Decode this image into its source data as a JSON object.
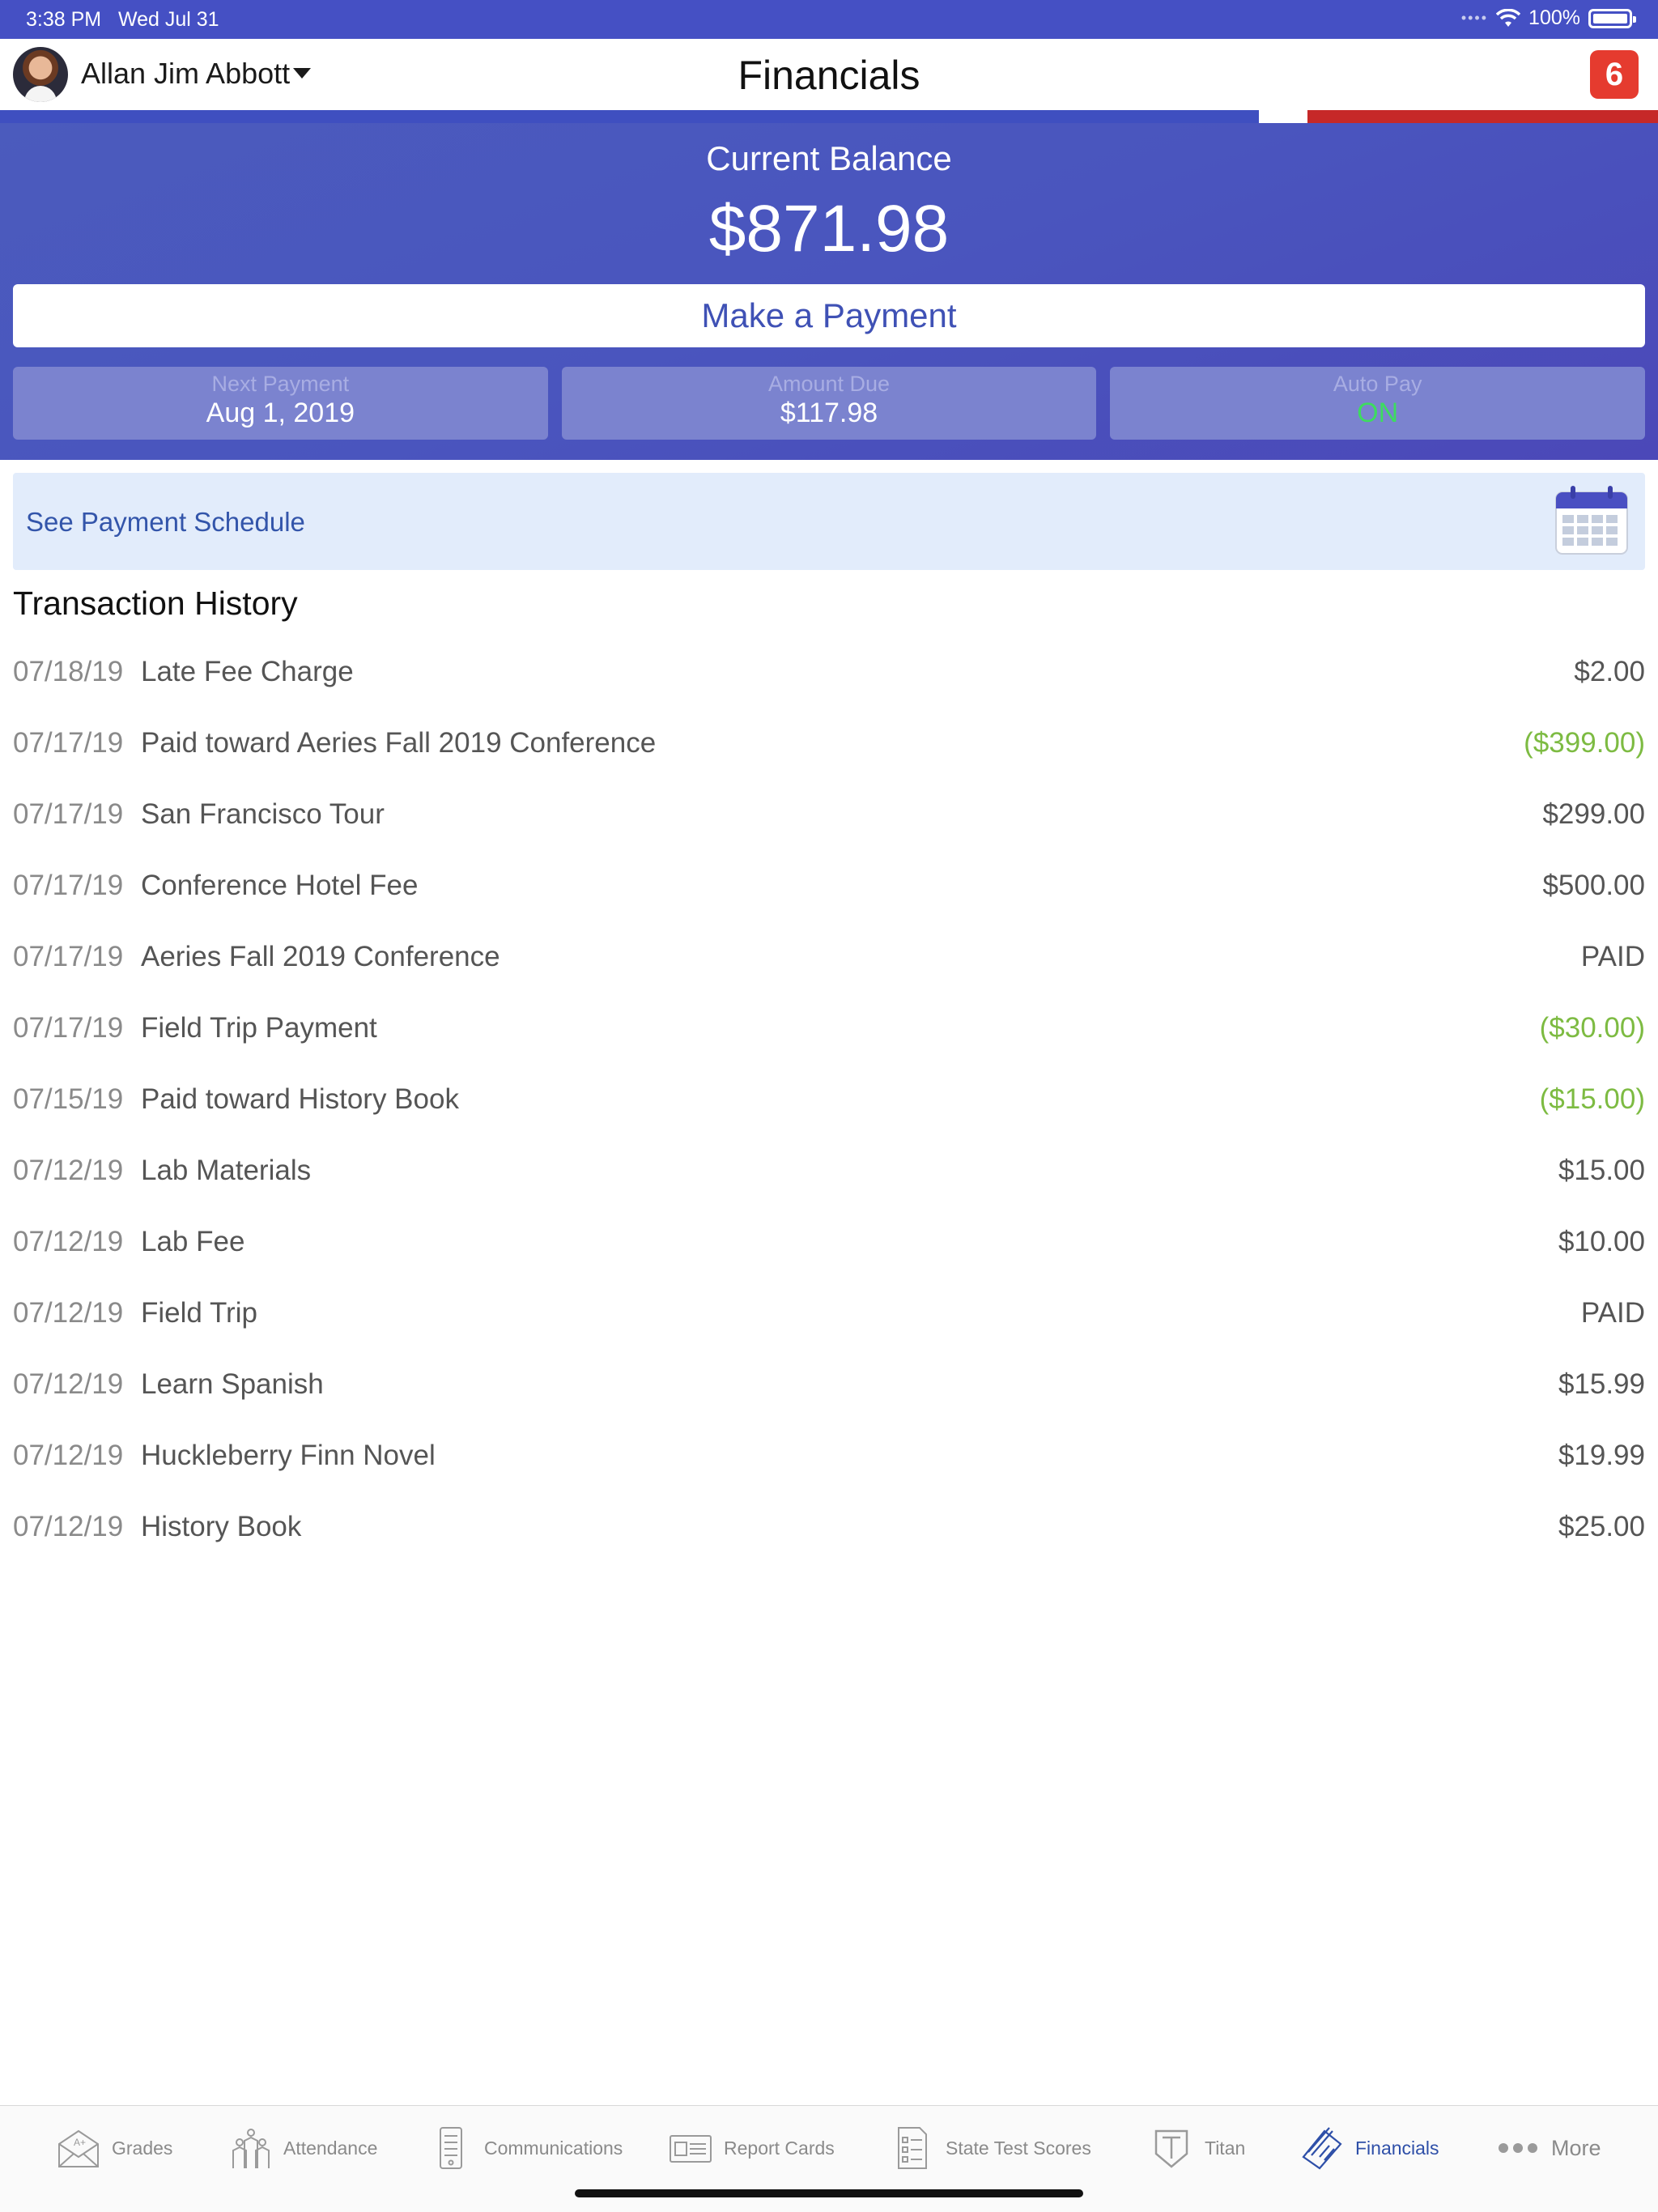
{
  "status_bar": {
    "time": "3:38 PM",
    "date": "Wed Jul 31",
    "battery": "100%"
  },
  "header": {
    "user_name": "Allan Jim Abbott",
    "title": "Financials",
    "notification_count": "6"
  },
  "balance": {
    "label": "Current Balance",
    "amount": "$871.98",
    "pay_button": "Make a Payment",
    "tiles": [
      {
        "label": "Next Payment",
        "value": "Aug 1, 2019"
      },
      {
        "label": "Amount Due",
        "value": "$117.98"
      },
      {
        "label": "Auto Pay",
        "value": "ON"
      }
    ]
  },
  "schedule": {
    "label": "See Payment Schedule",
    "icon": "calendar-icon"
  },
  "transactions": {
    "title": "Transaction History",
    "rows": [
      {
        "date": "07/18/19",
        "description": "Late Fee Charge",
        "amount": "$2.00"
      },
      {
        "date": "07/17/19",
        "description": "Paid toward Aeries Fall 2019 Conference",
        "amount": "($399.00)"
      },
      {
        "date": "07/17/19",
        "description": "San Francisco Tour",
        "amount": "$299.00"
      },
      {
        "date": "07/17/19",
        "description": "Conference Hotel Fee",
        "amount": "$500.00"
      },
      {
        "date": "07/17/19",
        "description": "Aeries Fall 2019 Conference",
        "amount": "PAID"
      },
      {
        "date": "07/17/19",
        "description": "Field Trip Payment",
        "amount": "($30.00)"
      },
      {
        "date": "07/15/19",
        "description": "Paid toward History Book",
        "amount": "($15.00)"
      },
      {
        "date": "07/12/19",
        "description": "Lab Materials",
        "amount": "$15.00"
      },
      {
        "date": "07/12/19",
        "description": "Lab Fee",
        "amount": "$10.00"
      },
      {
        "date": "07/12/19",
        "description": "Field Trip",
        "amount": "PAID"
      },
      {
        "date": "07/12/19",
        "description": "Learn Spanish",
        "amount": "$15.99"
      },
      {
        "date": "07/12/19",
        "description": "Huckleberry Finn Novel",
        "amount": "$19.99"
      },
      {
        "date": "07/12/19",
        "description": "History Book",
        "amount": "$25.00"
      }
    ]
  },
  "tabs": [
    {
      "label": "Grades",
      "icon": "grades-icon"
    },
    {
      "label": "Attendance",
      "icon": "attendance-icon"
    },
    {
      "label": "Communications",
      "icon": "communications-icon"
    },
    {
      "label": "Report Cards",
      "icon": "report-cards-icon"
    },
    {
      "label": "State Test Scores",
      "icon": "state-test-scores-icon"
    },
    {
      "label": "Titan",
      "icon": "titan-icon"
    },
    {
      "label": "Financials",
      "icon": "financials-icon",
      "active": true
    },
    {
      "label": "More",
      "icon": "more-icon"
    }
  ],
  "colors": {
    "accent": "#4550c4",
    "brand_red": "#c62828",
    "credit_green": "#7dbb42",
    "autopay_on": "#3ddc5f",
    "notification_red": "#e53b2f"
  }
}
